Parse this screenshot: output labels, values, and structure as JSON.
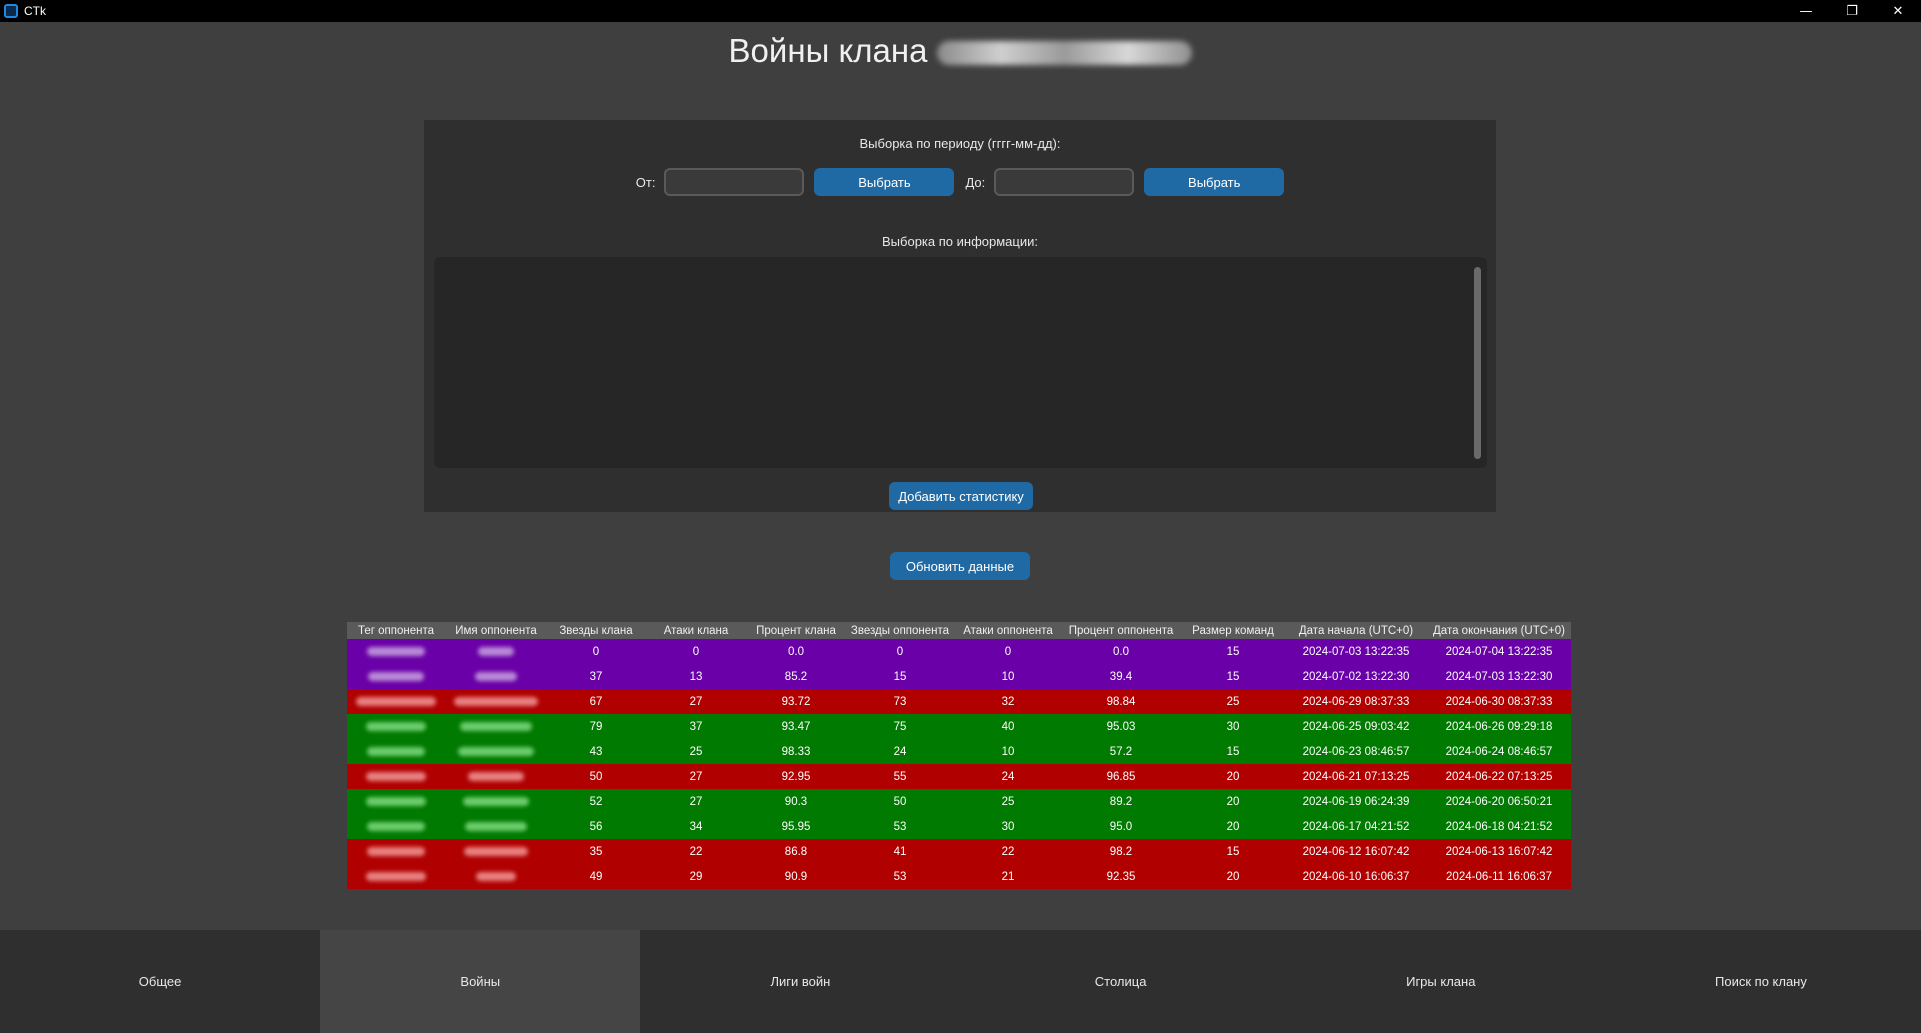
{
  "app": {
    "title": "CTk"
  },
  "window_controls": {
    "minimize": "—",
    "restore": "❐",
    "close": "✕"
  },
  "page": {
    "title": "Войны клана"
  },
  "filters": {
    "period_label": "Выборка по периоду (гггг-мм-дд):",
    "from_label": "От:",
    "from_value": "",
    "select_button": "Выбрать",
    "to_label": "До:",
    "to_value": "",
    "select_button_2": "Выбрать",
    "info_label": "Выборка по информации:",
    "add_stats_button": "Добавить статистику"
  },
  "refresh_button": "Обновить данные",
  "table": {
    "headers": [
      "Тег оппонента",
      "Имя оппонента",
      "Звезды клана",
      "Атаки клана",
      "Процент клана",
      "Звезды оппонента",
      "Атаки оппонента",
      "Процент оппонента",
      "Размер команд",
      "Дата начала (UTC+0)",
      "Дата окончания (UTC+0)"
    ],
    "rows": [
      {
        "status": "purple",
        "clan_stars": "0",
        "clan_attacks": "0",
        "clan_percent": "0.0",
        "opp_stars": "0",
        "opp_attacks": "0",
        "opp_percent": "0.0",
        "team_size": "15",
        "start": "2024-07-03 13:22:35",
        "end": "2024-07-04 13:22:35"
      },
      {
        "status": "purple",
        "clan_stars": "37",
        "clan_attacks": "13",
        "clan_percent": "85.2",
        "opp_stars": "15",
        "opp_attacks": "10",
        "opp_percent": "39.4",
        "team_size": "15",
        "start": "2024-07-02 13:22:30",
        "end": "2024-07-03 13:22:30"
      },
      {
        "status": "red",
        "clan_stars": "67",
        "clan_attacks": "27",
        "clan_percent": "93.72",
        "opp_stars": "73",
        "opp_attacks": "32",
        "opp_percent": "98.84",
        "team_size": "25",
        "start": "2024-06-29 08:37:33",
        "end": "2024-06-30 08:37:33"
      },
      {
        "status": "green",
        "clan_stars": "79",
        "clan_attacks": "37",
        "clan_percent": "93.47",
        "opp_stars": "75",
        "opp_attacks": "40",
        "opp_percent": "95.03",
        "team_size": "30",
        "start": "2024-06-25 09:03:42",
        "end": "2024-06-26 09:29:18"
      },
      {
        "status": "green",
        "clan_stars": "43",
        "clan_attacks": "25",
        "clan_percent": "98.33",
        "opp_stars": "24",
        "opp_attacks": "10",
        "opp_percent": "57.2",
        "team_size": "15",
        "start": "2024-06-23 08:46:57",
        "end": "2024-06-24 08:46:57"
      },
      {
        "status": "red",
        "clan_stars": "50",
        "clan_attacks": "27",
        "clan_percent": "92.95",
        "opp_stars": "55",
        "opp_attacks": "24",
        "opp_percent": "96.85",
        "team_size": "20",
        "start": "2024-06-21 07:13:25",
        "end": "2024-06-22 07:13:25"
      },
      {
        "status": "green",
        "clan_stars": "52",
        "clan_attacks": "27",
        "clan_percent": "90.3",
        "opp_stars": "50",
        "opp_attacks": "25",
        "opp_percent": "89.2",
        "team_size": "20",
        "start": "2024-06-19 06:24:39",
        "end": "2024-06-20 06:50:21"
      },
      {
        "status": "green",
        "clan_stars": "56",
        "clan_attacks": "34",
        "clan_percent": "95.95",
        "opp_stars": "53",
        "opp_attacks": "30",
        "opp_percent": "95.0",
        "team_size": "20",
        "start": "2024-06-17 04:21:52",
        "end": "2024-06-18 04:21:52"
      },
      {
        "status": "red",
        "clan_stars": "35",
        "clan_attacks": "22",
        "clan_percent": "86.8",
        "opp_stars": "41",
        "opp_attacks": "22",
        "opp_percent": "98.2",
        "team_size": "15",
        "start": "2024-06-12 16:07:42",
        "end": "2024-06-13 16:07:42"
      },
      {
        "status": "red",
        "clan_stars": "49",
        "clan_attacks": "29",
        "clan_percent": "90.9",
        "opp_stars": "53",
        "opp_attacks": "21",
        "opp_percent": "92.35",
        "team_size": "20",
        "start": "2024-06-10 16:06:37",
        "end": "2024-06-11 16:06:37"
      }
    ]
  },
  "tabs": [
    {
      "label": "Общее",
      "active": false
    },
    {
      "label": "Войны",
      "active": true
    },
    {
      "label": "Лиги войн",
      "active": false
    },
    {
      "label": "Столица",
      "active": false
    },
    {
      "label": "Игры клана",
      "active": false
    },
    {
      "label": "Поиск по клану",
      "active": false
    }
  ],
  "colors": {
    "win": "#007a00",
    "loss": "#b00000",
    "ongoing": "#6a00a8",
    "button": "#1f6aa5",
    "background": "#3f3f3f"
  }
}
